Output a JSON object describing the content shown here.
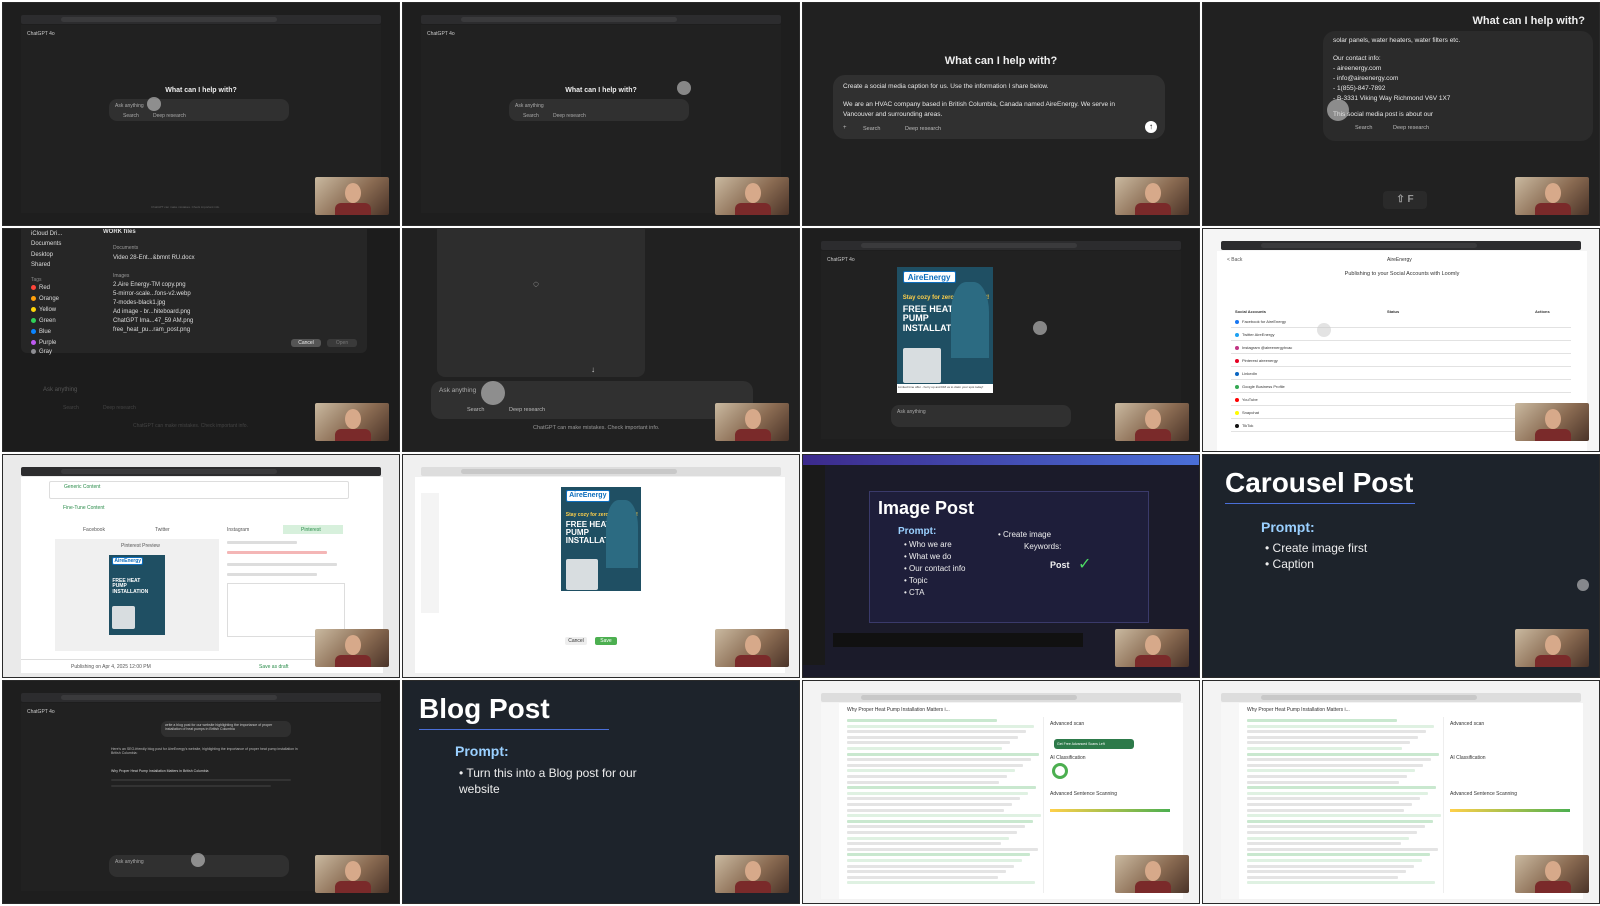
{
  "frame1": {
    "app_title": "ChatGPT 4o",
    "heading": "What can I help with?",
    "placeholder": "Ask anything",
    "search": "Search",
    "deep_research": "Deep research",
    "footer": "ChatGPT can make mistakes. Check important info."
  },
  "frame2": {
    "app_title": "ChatGPT 4o",
    "heading": "What can I help with?",
    "placeholder": "Ask anything",
    "search": "Search",
    "deep_research": "Deep research"
  },
  "frame3": {
    "heading": "What can I help with?",
    "line1": "Create a social media caption for us. Use the information I share below.",
    "line2": "We are an HVAC company based in British Columbia, Canada named AireEnergy. We serve in",
    "line3": "Vancouver and surrounding areas.",
    "search": "Search",
    "deep_research": "Deep research"
  },
  "frame4": {
    "heading": "What can I help with?",
    "line1": "solar panels, water heaters, water filters etc.",
    "line2": "Our contact info:",
    "line3": "- aireenergy.com",
    "line4": "- info@aireenergy.com",
    "line5": "- 1(855)-847-7892",
    "line6": "- B-3331 Viking Way Richmond V6V 1X7",
    "line7": "This social media post is about our",
    "search": "Search",
    "deep_research": "Deep research",
    "key_hint": "⇧ F"
  },
  "frame5": {
    "sidebar": [
      "iCloud Dri...",
      "Documents",
      "Desktop",
      "Shared"
    ],
    "tags_label": "Tags",
    "tags": [
      {
        "name": "Red",
        "color": "#ff453a"
      },
      {
        "name": "Orange",
        "color": "#ff9f0a"
      },
      {
        "name": "Yellow",
        "color": "#ffd60a"
      },
      {
        "name": "Green",
        "color": "#30d158"
      },
      {
        "name": "Blue",
        "color": "#0a84ff"
      },
      {
        "name": "Purple",
        "color": "#bf5af2"
      },
      {
        "name": "Gray",
        "color": "#8e8e93"
      }
    ],
    "folder": "WORK files",
    "documents_label": "Documents",
    "document": "Video 28-Ent...&bmnt RU.docx",
    "images_label": "Images",
    "images": [
      "2.Aire Energy-TM copy.png",
      "5-mirror-scale...fons-v2.webp",
      "7-modes-black1.jpg",
      "Ad image - br...hiteboard.png",
      "ChatGPT Ima...47_59 AM.png",
      "free_heat_pu...ram_post.png"
    ],
    "cancel": "Cancel",
    "open": "Open",
    "placeholder": "Ask anything",
    "search": "Search",
    "deep_research": "Deep research",
    "footer": "ChatGPT can make mistakes. Check important info."
  },
  "frame6": {
    "placeholder": "Ask anything",
    "search": "Search",
    "deep_research": "Deep research",
    "footer": "ChatGPT can make mistakes. Check important info."
  },
  "ad": {
    "logo": "AireEnergy",
    "tagline": "Stay cozy for zero install cost!",
    "headline": "FREE HEAT PUMP INSTALLATION",
    "footer": "Limited time offer - hurry up and DM us to claim your spot today!"
  },
  "frame7": {
    "app_title": "ChatGPT 4o",
    "placeholder": "Ask anything"
  },
  "frame8": {
    "brand": "AireEnergy",
    "back": "< Back",
    "title": "Publishing to your Social Accounts with Loomly",
    "col_accounts": "Social Accounts",
    "col_status": "Status",
    "col_actions": "Actions",
    "accounts": [
      {
        "name": "Facebook for AireEnergy",
        "color": "#1877f2"
      },
      {
        "name": "Twitter AireEnergy",
        "color": "#1da1f2"
      },
      {
        "name": "Instagram @aireenergyhvac",
        "color": "#c13584"
      },
      {
        "name": "Pinterest aireenergy",
        "color": "#e60023"
      },
      {
        "name": "LinkedIn",
        "color": "#0a66c2"
      },
      {
        "name": "Google Business Profile",
        "color": "#34a853"
      },
      {
        "name": "YouTube",
        "color": "#ff0000"
      },
      {
        "name": "Snapchat",
        "color": "#fffc00"
      },
      {
        "name": "TikTok",
        "color": "#111111"
      }
    ]
  },
  "frame9": {
    "generic": "Generic Content",
    "finetune": "Fine-Tune Content",
    "tabs": [
      "Facebook",
      "Twitter",
      "Instagram",
      "Pinterest"
    ],
    "preview": "Pinterest Preview",
    "footer": "Publishing on Apr 4, 2025 12:00 PM",
    "save_draft": "Save as draft"
  },
  "frame10": {
    "cancel": "Cancel",
    "save": "Save"
  },
  "frame11": {
    "title": "Image Post",
    "prompt": "Prompt:",
    "bullets": [
      "Who we are",
      "What we do",
      "Our contact info",
      "Topic",
      "CTA"
    ],
    "bullet2a": "Create image",
    "bullet2b": "Keywords:",
    "post": "Post",
    "check": "✓"
  },
  "frame12": {
    "title": "Carousel Post",
    "prompt": "Prompt:",
    "bullets": [
      "Create image first",
      "Caption"
    ]
  },
  "frame13": {
    "app_title": "ChatGPT 4o",
    "user_msg": "write a blog post for our website highlighting the importance of proper installation of heat pumps in British Columbia",
    "reply1": "Here's an SEO-friendly blog post for AireEnergy's website, highlighting the importance of proper heat pump installation in British Columbia:",
    "reply2": "Why Proper Heat Pump Installation Matters in British Columbia",
    "placeholder": "Ask anything"
  },
  "frame14": {
    "title": "Blog Post",
    "prompt": "Prompt:",
    "bullet": "Turn this into a Blog post for our website"
  },
  "frame15": {
    "doc_title": "Why Proper Heat Pump Installation Matters i...",
    "panel_title": "Advanced scan",
    "classification": "AI Classification",
    "advanced": "Advanced Sentence Scanning",
    "button": "Get Free Advanced Scans Left"
  },
  "frame16": {
    "doc_title": "Why Proper Heat Pump Installation Matters i...",
    "panel_title": "Advanced scan",
    "classification": "AI Classification",
    "advanced": "Advanced Sentence Scanning"
  }
}
